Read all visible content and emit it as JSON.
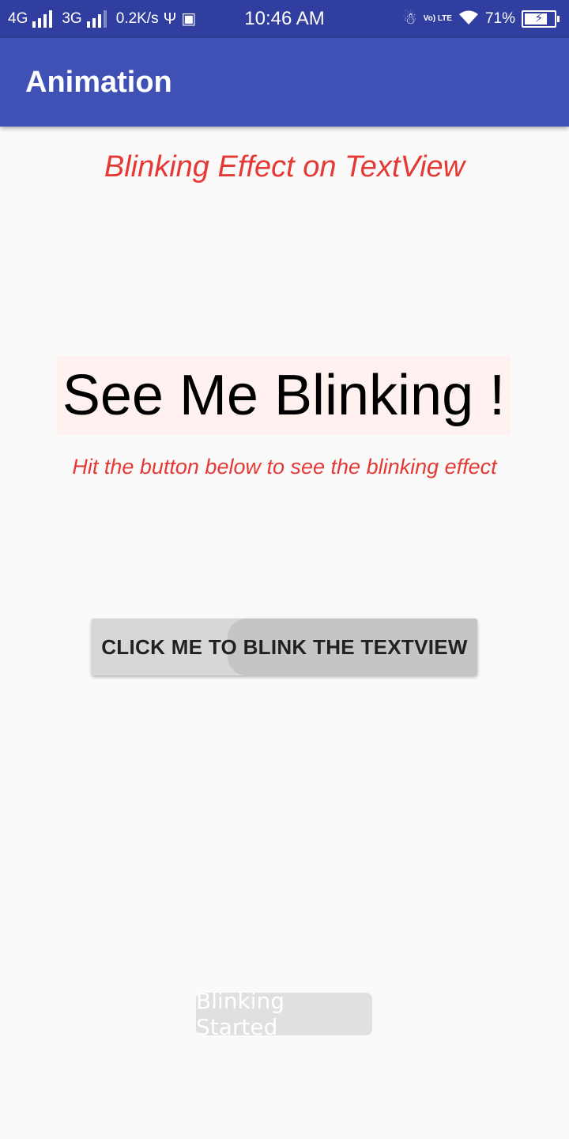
{
  "status_bar": {
    "network_4g": "4G",
    "network_3g": "3G",
    "speed": "0.2K/s",
    "time": "10:46 AM",
    "volte": "Vo) LTE",
    "battery_percent": "71%",
    "battery_level": 0.71,
    "icons": [
      "signal-icon",
      "usb-icon",
      "vpn-icon",
      "alarm-off-icon",
      "wifi-icon",
      "battery-icon"
    ]
  },
  "app_bar": {
    "title": "Animation",
    "color": "#3f51b5"
  },
  "main": {
    "heading": "Blinking Effect on TextView",
    "blink_text": "See Me Blinking !",
    "hint": "Hit the button below to see the blinking effect",
    "button_label": "CLICK ME TO BLINK THE TEXTVIEW",
    "accent_color": "#e53935"
  },
  "toast": {
    "message": "Blinking Started"
  }
}
